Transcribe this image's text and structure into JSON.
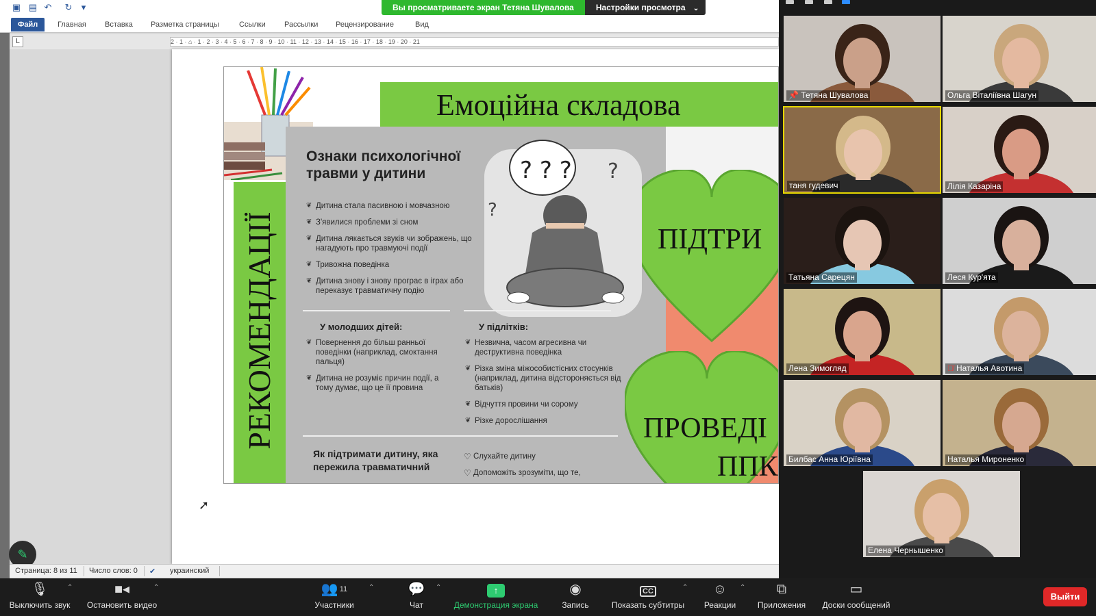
{
  "banner": {
    "message": "Вы просматриваете экран Тетяна Шувалова",
    "settings_label": "Настройки просмотра"
  },
  "word": {
    "tabs": [
      "Файл",
      "Главная",
      "Вставка",
      "Разметка страницы",
      "Ссылки",
      "Рассылки",
      "Рецензирование",
      "Вид"
    ],
    "ruler_marks": "2 · 1 · ⌂ · 1 · 2 · 3 · 4 · 5 · 6 · 7 · 8 · 9 · 10 · 11 · 12 · 13 · 14 · 15 · 16 · 17 · 18 · 19 · 20 · 21",
    "ruler_corner": "L",
    "status": {
      "page": "Страница: 8 из 11",
      "words": "Число слов: 0",
      "language": "украинский"
    }
  },
  "poster": {
    "title": "Емоційна складова",
    "left_vertical": "РЕКОМЕНДАЦІЇ",
    "heart_text_1": "ПІДТРИ",
    "heart_text_2": "ПРОВЕДІ",
    "heart_text_3": "ППК",
    "signs_title": "Ознаки психологічної травми у дитини",
    "signs": [
      "Дитина стала пасивною і мовчазною",
      "З'явилися проблеми зі сном",
      "Дитина лякається звуків чи зображень, що нагадують про травмуючі події",
      "Тривожна поведінка",
      "Дитина знову і знову програє в іграх або переказує травматичну подію"
    ],
    "young_title": "У молодших дітей:",
    "young": [
      "Повернення до більш ранньої поведінки (наприклад, смоктання пальця)",
      "Дитина не розуміє причин події, а тому думає, що це її провина"
    ],
    "teen_title": "У підлітків:",
    "teen": [
      "Незвична, часом агресивна чи деструктивна поведінка",
      "Різка зміна міжособистісних стосунків (наприклад, дитина відстороняється від батьків)",
      "Відчуття провини чи сорому",
      "Різке дорослішання"
    ],
    "support_title": "Як підтримати дитину, яка пережила травматичний",
    "support": [
      "Слухайте дитину",
      "Допоможіть зрозуміти, що те,"
    ]
  },
  "participants": [
    {
      "name": "Тетяна Шувалова",
      "pinned": true,
      "bg": "#c9c3bd",
      "skin": "#caa089",
      "hair": "#3a2418",
      "shirt": "#8a5a3c"
    },
    {
      "name": "Ольга Віталіївна Шагун",
      "bg": "#d8d4cc",
      "skin": "#e4b9a0",
      "hair": "#c9a77c",
      "shirt": "#3a3a3a"
    },
    {
      "name": "таня гудевич",
      "active": true,
      "bg": "#8a6a48",
      "skin": "#e8c4ad",
      "hair": "#d4b98a",
      "shirt": "#2a2a2a"
    },
    {
      "name": "Лілія Казаріна",
      "bg": "#d8d0c8",
      "skin": "#d99b85",
      "hair": "#2a1a14",
      "shirt": "#c43030"
    },
    {
      "name": "Татьяна Сарецян",
      "bg": "#2a1e1a",
      "skin": "#e6c6b4",
      "hair": "#1c1410",
      "shirt": "#87c9e0"
    },
    {
      "name": "Леся Кур'ята",
      "bg": "#cfcfcf",
      "skin": "#d8b09c",
      "hair": "#1a1412",
      "shirt": "#1a1a1a"
    },
    {
      "name": "Лена Зимогляд",
      "bg": "#c8b98a",
      "skin": "#d9a58d",
      "hair": "#1e1412",
      "shirt": "#c42424"
    },
    {
      "name": "Наталья Авотина",
      "muted": true,
      "bg": "#dcdcdc",
      "skin": "#dcb39c",
      "hair": "#c49a6a",
      "shirt": "#3b4a5c"
    },
    {
      "name": "Билбас Анна Юріївна",
      "bg": "#d9d2c6",
      "skin": "#e1b8a2",
      "hair": "#b49262",
      "shirt": "#2b4a8a"
    },
    {
      "name": "Наталья Мироненко",
      "bg": "#c4b28e",
      "skin": "#d6a890",
      "hair": "#9a6a3a",
      "shirt": "#2a2a3a"
    },
    {
      "name": "Елена Чернышенко",
      "bg": "#dad6d2",
      "skin": "#e6bfa6",
      "hair": "#c9a06c",
      "shirt": "#4a4a4a"
    }
  ],
  "controls": {
    "mute": "Выключить звук",
    "video": "Остановить видео",
    "participants": "Участники",
    "participants_count": "11",
    "chat": "Чат",
    "share": "Демонстрация экрана",
    "record": "Запись",
    "captions": "Показать субтитры",
    "captions_icon": "CC",
    "reactions": "Реакции",
    "apps": "Приложения",
    "whiteboards": "Доски сообщений",
    "leave": "Выйти"
  },
  "colors": {
    "zoom_green": "#2ecc71",
    "poster_green": "#7ac943",
    "poster_coral": "#f08a6e",
    "active_speaker": "#e6d800",
    "leave_red": "#e02828"
  }
}
